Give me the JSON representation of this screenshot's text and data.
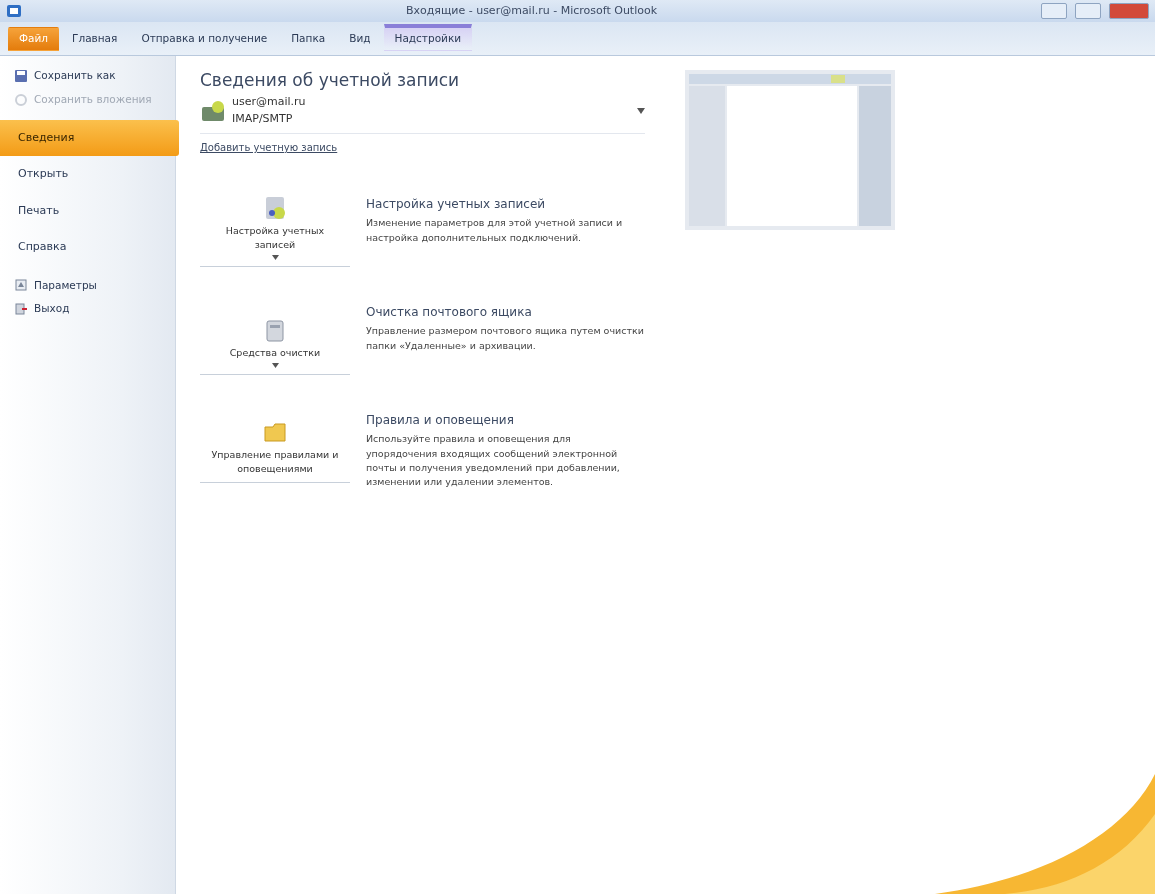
{
  "window": {
    "title": "Входящие - user@mail.ru - Microsoft Outlook"
  },
  "ribbon_tabs": [
    {
      "label": "Файл",
      "kind": "file",
      "selected": true
    },
    {
      "label": "Главная",
      "kind": "tab",
      "selected": false
    },
    {
      "label": "Отправка и получение",
      "kind": "tab",
      "selected": false
    },
    {
      "label": "Папка",
      "kind": "tab",
      "selected": false
    },
    {
      "label": "Вид",
      "kind": "tab",
      "selected": false
    },
    {
      "label": "Надстройки",
      "kind": "contextual",
      "selected": false
    }
  ],
  "sidebar": {
    "items": [
      {
        "label": "Сохранить как",
        "kind": "command",
        "disabled": false
      },
      {
        "label": "Сохранить вложения",
        "kind": "command",
        "disabled": true
      },
      {
        "label": "Сведения",
        "kind": "tab",
        "selected": true
      },
      {
        "label": "Открыть",
        "kind": "tab",
        "selected": false
      },
      {
        "label": "Печать",
        "kind": "tab",
        "selected": false
      },
      {
        "label": "Справка",
        "kind": "tab",
        "selected": false
      },
      {
        "label": "Параметры",
        "kind": "command",
        "disabled": false
      },
      {
        "label": "Выход",
        "kind": "command",
        "disabled": false
      }
    ]
  },
  "main": {
    "heading": "Сведения об учетной записи",
    "account": {
      "address": "user@mail.ru",
      "type": "IMAP/SMTP"
    },
    "add_account": "Добавить учетную запись",
    "actions": [
      {
        "button": "Настройка учетных записей",
        "dropdown": true,
        "title": "Настройка учетных записей",
        "description": "Изменение параметров для этой учетной записи и настройка дополнительных подключений."
      },
      {
        "button": "Средства очистки",
        "dropdown": true,
        "title": "Очистка почтового ящика",
        "description": "Управление размером почтового ящика путем очистки папки «Удаленные» и архивации."
      },
      {
        "button": "Управление правилами и оповещениями",
        "dropdown": false,
        "title": "Правила и оповещения",
        "description": "Используйте правила и оповещения для упорядочения входящих сообщений электронной почты и получения уведомлений при добавлении, изменении или удалении элементов."
      }
    ]
  }
}
